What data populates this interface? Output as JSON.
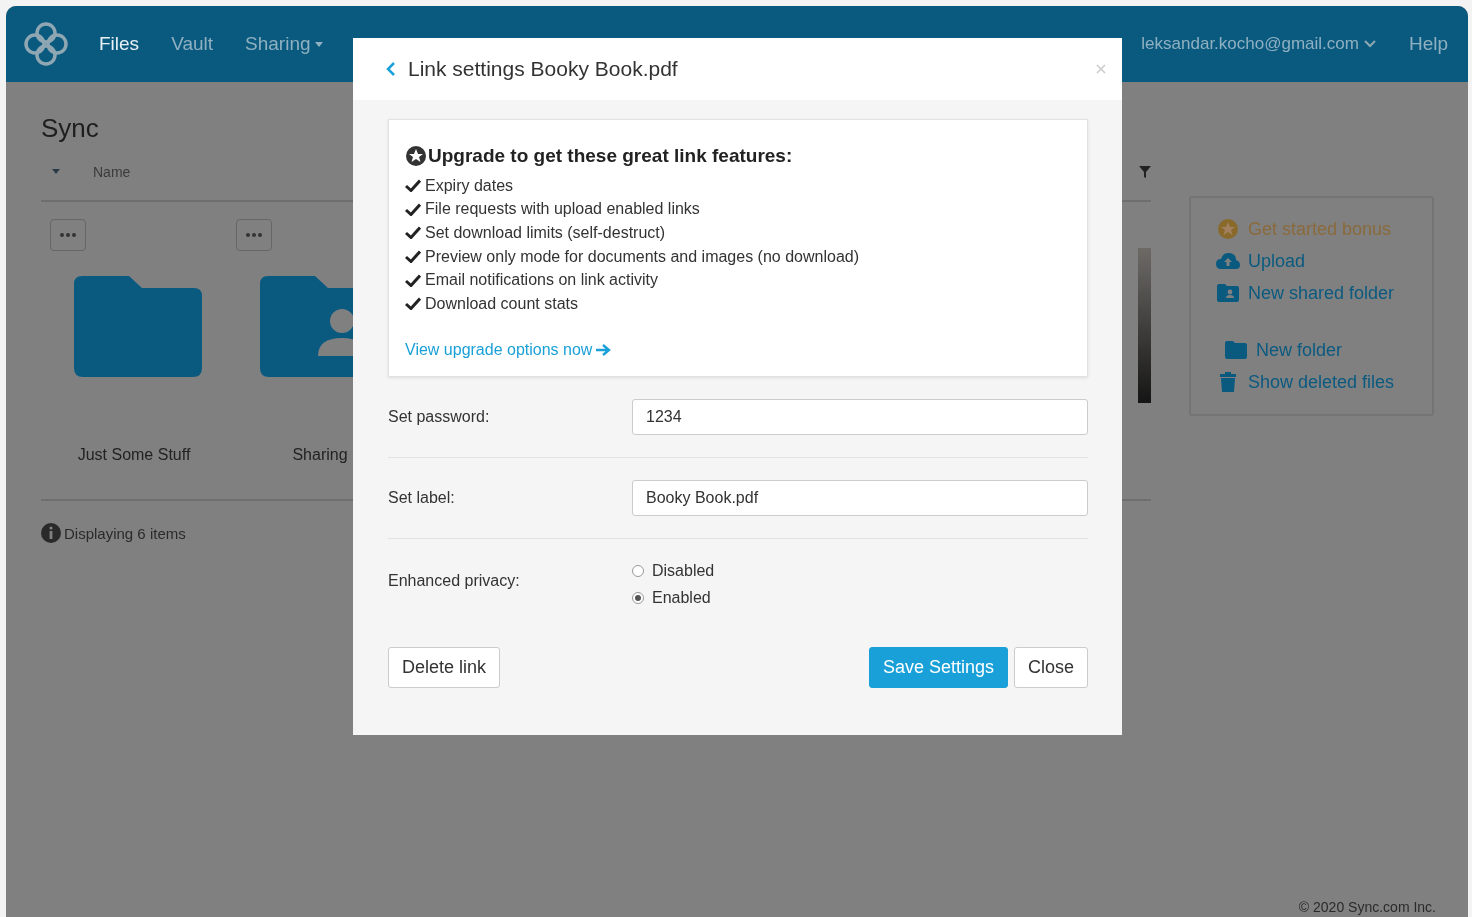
{
  "nav": {
    "items": [
      {
        "label": "Files",
        "selected": true,
        "dropdown": false
      },
      {
        "label": "Vault",
        "selected": false,
        "dropdown": false
      },
      {
        "label": "Sharing",
        "selected": false,
        "dropdown": true
      }
    ],
    "account": "leksandar.kocho@gmail.com",
    "help": "Help"
  },
  "page": {
    "title": "Sync",
    "column_header": "Name",
    "folders": [
      {
        "name": "Just Some Stuff",
        "kind": "folder"
      },
      {
        "name": "Sharing",
        "kind": "shared"
      }
    ],
    "status": "Displaying 6 items"
  },
  "actions": [
    {
      "label": "Get started bonus",
      "kind": "bonus"
    },
    {
      "label": "Upload",
      "kind": "upload"
    },
    {
      "label": "New shared folder",
      "kind": "shared-folder"
    },
    {
      "label": "New folder",
      "kind": "folder"
    },
    {
      "label": "Show deleted files",
      "kind": "trash"
    }
  ],
  "footer": "© 2020 Sync.com Inc.",
  "dialog": {
    "title": "Link settings Booky Book.pdf",
    "upgrade": {
      "heading": "Upgrade to get these great link features:",
      "features": [
        "Expiry dates",
        "File requests with upload enabled links",
        "Set download limits (self-destruct)",
        "Preview only mode for documents and images (no download)",
        "Email notifications on link activity",
        "Download count stats"
      ],
      "link": "View upgrade options now"
    },
    "password": {
      "label": "Set password:",
      "value": "1234"
    },
    "link_label": {
      "label": "Set label:",
      "value": "Booky Book.pdf"
    },
    "privacy": {
      "label": "Enhanced privacy:",
      "options": [
        {
          "label": "Disabled",
          "selected": false
        },
        {
          "label": "Enabled",
          "selected": true
        }
      ]
    },
    "buttons": [
      {
        "label": "Delete link",
        "kind": "default"
      },
      {
        "label": "Save Settings",
        "kind": "primary"
      },
      {
        "label": "Close",
        "kind": "default"
      }
    ]
  }
}
